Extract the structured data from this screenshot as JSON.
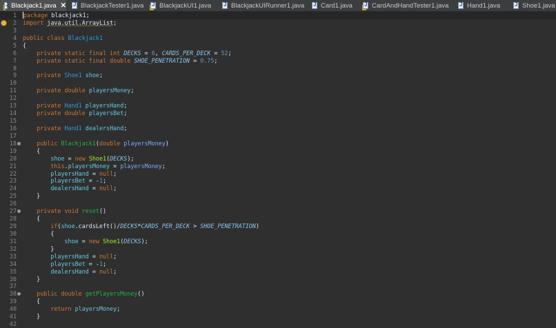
{
  "tabs": [
    {
      "label": "Blackjack1.java",
      "active": true,
      "warn": true
    },
    {
      "label": "BlackjackTester1.java"
    },
    {
      "label": "BlackjackUI1.java",
      "warn": true
    },
    {
      "label": "BlackjackUIRunner1.java"
    },
    {
      "label": "Card1.java"
    },
    {
      "label": "CardAndHandTester1.java",
      "warn": true
    },
    {
      "label": "Hand1.java"
    },
    {
      "label": "Shoe1.java"
    }
  ],
  "close_glyph": "✕",
  "code": [
    {
      "n": "1",
      "t": [
        [
          "kw",
          "package"
        ],
        [
          "p",
          " blackjack1;"
        ]
      ]
    },
    {
      "n": "2",
      "warn": true,
      "t": [
        [
          "kw",
          "import"
        ],
        [
          "p",
          " "
        ],
        [
          "imp",
          "java.util.ArrayList"
        ],
        [
          "p",
          ";"
        ]
      ]
    },
    {
      "n": "3",
      "t": []
    },
    {
      "n": "4",
      "t": [
        [
          "kw",
          "public class"
        ],
        [
          "p",
          " "
        ],
        [
          "cls",
          "Blackjack1"
        ]
      ]
    },
    {
      "n": "5",
      "t": [
        [
          "p",
          "{"
        ]
      ]
    },
    {
      "n": "6",
      "t": [
        [
          "kw",
          "    private static final int"
        ],
        [
          "p",
          " "
        ],
        [
          "cst",
          "DECKS"
        ],
        [
          "p",
          " = "
        ],
        [
          "num",
          "6"
        ],
        [
          "p",
          ", "
        ],
        [
          "cst",
          "CARDS_PER_DECK"
        ],
        [
          "p",
          " = "
        ],
        [
          "num",
          "52"
        ],
        [
          "p",
          ";"
        ]
      ]
    },
    {
      "n": "7",
      "t": [
        [
          "kw",
          "    private static final double"
        ],
        [
          "p",
          " "
        ],
        [
          "cst",
          "SHOE_PENETRATION"
        ],
        [
          "p",
          " = "
        ],
        [
          "num",
          "0.75"
        ],
        [
          "p",
          ";"
        ]
      ]
    },
    {
      "n": "8",
      "t": []
    },
    {
      "n": "9",
      "t": [
        [
          "kw",
          "    private"
        ],
        [
          "p",
          " "
        ],
        [
          "cls",
          "Shoe1"
        ],
        [
          "p",
          " "
        ],
        [
          "fld",
          "shoe"
        ],
        [
          "p",
          ";"
        ]
      ]
    },
    {
      "n": "10",
      "t": []
    },
    {
      "n": "11",
      "t": [
        [
          "kw",
          "    private double"
        ],
        [
          "p",
          " "
        ],
        [
          "fld",
          "playersMoney"
        ],
        [
          "p",
          ";"
        ]
      ]
    },
    {
      "n": "12",
      "t": []
    },
    {
      "n": "13",
      "t": [
        [
          "kw",
          "    private"
        ],
        [
          "p",
          " "
        ],
        [
          "cls",
          "Hand1"
        ],
        [
          "p",
          " "
        ],
        [
          "fld",
          "playersHand"
        ],
        [
          "p",
          ";"
        ]
      ]
    },
    {
      "n": "14",
      "t": [
        [
          "kw",
          "    private double"
        ],
        [
          "p",
          " "
        ],
        [
          "fld",
          "playersBet"
        ],
        [
          "p",
          ";"
        ]
      ]
    },
    {
      "n": "15",
      "t": []
    },
    {
      "n": "16",
      "t": [
        [
          "kw",
          "    private"
        ],
        [
          "p",
          " "
        ],
        [
          "cls",
          "Hand1"
        ],
        [
          "p",
          " "
        ],
        [
          "fld",
          "dealersHand"
        ],
        [
          "p",
          ";"
        ]
      ]
    },
    {
      "n": "17",
      "t": []
    },
    {
      "n": "18",
      "mark": true,
      "t": [
        [
          "kw",
          "    public"
        ],
        [
          "p",
          " "
        ],
        [
          "mth",
          "Blackjack1"
        ],
        [
          "p",
          "("
        ],
        [
          "kw",
          "double"
        ],
        [
          "p",
          " "
        ],
        [
          "prm",
          "playersMoney"
        ],
        [
          "p",
          ")"
        ]
      ]
    },
    {
      "n": "19",
      "t": [
        [
          "p",
          "    {"
        ]
      ]
    },
    {
      "n": "20",
      "t": [
        [
          "fld",
          "        shoe"
        ],
        [
          "p",
          " = "
        ],
        [
          "kw",
          "new"
        ],
        [
          "p",
          " "
        ],
        [
          "ctor",
          "Shoe1"
        ],
        [
          "p",
          "("
        ],
        [
          "cst",
          "DECKS"
        ],
        [
          "p",
          ");"
        ]
      ]
    },
    {
      "n": "21",
      "t": [
        [
          "kw",
          "        this"
        ],
        [
          "p",
          "."
        ],
        [
          "fld",
          "playersMoney"
        ],
        [
          "p",
          " = "
        ],
        [
          "prm",
          "playersMoney"
        ],
        [
          "p",
          ";"
        ]
      ]
    },
    {
      "n": "22",
      "t": [
        [
          "fld",
          "        playersHand"
        ],
        [
          "p",
          " = "
        ],
        [
          "kw",
          "null"
        ],
        [
          "p",
          ";"
        ]
      ]
    },
    {
      "n": "23",
      "t": [
        [
          "fld",
          "        playersBet"
        ],
        [
          "p",
          " = -"
        ],
        [
          "num",
          "1"
        ],
        [
          "p",
          ";"
        ]
      ]
    },
    {
      "n": "24",
      "t": [
        [
          "fld",
          "        dealersHand"
        ],
        [
          "p",
          " = "
        ],
        [
          "kw",
          "null"
        ],
        [
          "p",
          ";"
        ]
      ]
    },
    {
      "n": "25",
      "t": [
        [
          "p",
          "    }"
        ]
      ]
    },
    {
      "n": "26",
      "t": []
    },
    {
      "n": "27",
      "mark": true,
      "t": [
        [
          "kw",
          "    private void"
        ],
        [
          "p",
          " "
        ],
        [
          "mth",
          "reset"
        ],
        [
          "p",
          "()"
        ]
      ]
    },
    {
      "n": "28",
      "t": [
        [
          "p",
          "    {"
        ]
      ]
    },
    {
      "n": "29",
      "t": [
        [
          "kw",
          "        if"
        ],
        [
          "p",
          "("
        ],
        [
          "fld",
          "shoe"
        ],
        [
          "p",
          ".cardsLeft()/"
        ],
        [
          "cst",
          "DECKS"
        ],
        [
          "p",
          "*"
        ],
        [
          "cst",
          "CARDS_PER_DECK"
        ],
        [
          "p",
          " > "
        ],
        [
          "cst",
          "SHOE_PENETRATION"
        ],
        [
          "p",
          ")"
        ]
      ]
    },
    {
      "n": "30",
      "t": [
        [
          "p",
          "        {"
        ]
      ]
    },
    {
      "n": "31",
      "t": [
        [
          "fld",
          "            shoe"
        ],
        [
          "p",
          " = "
        ],
        [
          "kw",
          "new"
        ],
        [
          "p",
          " "
        ],
        [
          "ctor",
          "Shoe1"
        ],
        [
          "p",
          "("
        ],
        [
          "cst",
          "DECKS"
        ],
        [
          "p",
          ");"
        ]
      ]
    },
    {
      "n": "32",
      "t": [
        [
          "p",
          "        }"
        ]
      ]
    },
    {
      "n": "33",
      "t": [
        [
          "fld",
          "        playersHand"
        ],
        [
          "p",
          " = "
        ],
        [
          "kw",
          "null"
        ],
        [
          "p",
          ";"
        ]
      ]
    },
    {
      "n": "34",
      "t": [
        [
          "fld",
          "        playersBet"
        ],
        [
          "p",
          " = -"
        ],
        [
          "num",
          "1"
        ],
        [
          "p",
          ";"
        ]
      ]
    },
    {
      "n": "35",
      "t": [
        [
          "fld",
          "        dealersHand"
        ],
        [
          "p",
          " = "
        ],
        [
          "kw",
          "null"
        ],
        [
          "p",
          ";"
        ]
      ]
    },
    {
      "n": "36",
      "t": [
        [
          "p",
          "    }"
        ]
      ]
    },
    {
      "n": "37",
      "t": []
    },
    {
      "n": "38",
      "mark": true,
      "t": [
        [
          "kw",
          "    public double"
        ],
        [
          "p",
          " "
        ],
        [
          "mth",
          "getPlayersMoney"
        ],
        [
          "p",
          "()"
        ]
      ]
    },
    {
      "n": "39",
      "t": [
        [
          "p",
          "    {"
        ]
      ]
    },
    {
      "n": "40",
      "t": [
        [
          "kw",
          "        return"
        ],
        [
          "p",
          " "
        ],
        [
          "fld",
          "playersMoney"
        ],
        [
          "p",
          ";"
        ]
      ]
    },
    {
      "n": "41",
      "t": [
        [
          "p",
          "    }"
        ]
      ]
    },
    {
      "n": "42",
      "t": []
    }
  ]
}
